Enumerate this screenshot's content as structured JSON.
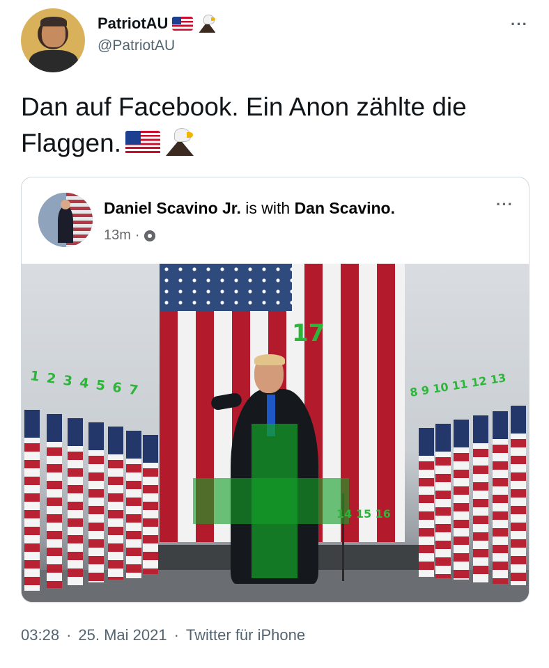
{
  "tweet": {
    "display_name": "PatriotAU",
    "handle": "@PatriotAU",
    "more_label": "···",
    "name_emojis": [
      "flag-us-icon",
      "eagle-icon"
    ],
    "text": "Dan auf Facebook. Ein Anon zählte die Flaggen.",
    "text_emojis": [
      "flag-us-icon",
      "eagle-icon"
    ],
    "time": "03:28",
    "date": "25. Mai 2021",
    "separator": "·",
    "source": "Twitter für iPhone"
  },
  "embedded_post": {
    "author": "Daniel Scavino Jr.",
    "connector": " is with ",
    "with_name": "Dan Scavino.",
    "age": "13m",
    "dot": "·",
    "privacy_icon": "gear-icon",
    "more_label": "···",
    "photo": {
      "annotation_top": "17",
      "annotation_left": "1 2 3 4 5 6 7",
      "annotation_right": "8 9 10 11 12 13",
      "annotation_mid": "14 15 16",
      "overlay_color": "#14a028",
      "annotation_color": "#2db53a"
    }
  },
  "colors": {
    "text_primary": "#0f1419",
    "text_secondary": "#536471",
    "border": "#cfd9de"
  }
}
